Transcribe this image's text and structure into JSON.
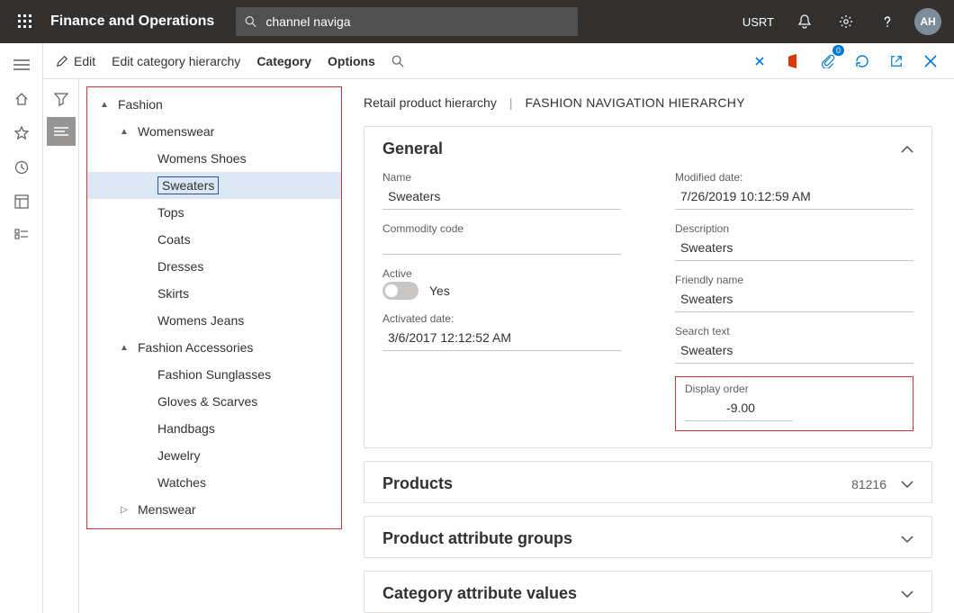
{
  "header": {
    "app_title": "Finance and Operations",
    "search_value": "channel naviga",
    "company": "USRT",
    "avatar": "AH"
  },
  "actionbar": {
    "edit": "Edit",
    "edit_hierarchy": "Edit category hierarchy",
    "category": "Category",
    "options": "Options"
  },
  "tree": {
    "root": "Fashion",
    "groups": [
      {
        "label": "Womenswear",
        "children": [
          "Womens Shoes",
          "Sweaters",
          "Tops",
          "Coats",
          "Dresses",
          "Skirts",
          "Womens Jeans"
        ],
        "selected_index": 1
      },
      {
        "label": "Fashion Accessories",
        "children": [
          "Fashion Sunglasses",
          "Gloves & Scarves",
          "Handbags",
          "Jewelry",
          "Watches"
        ]
      },
      {
        "label": "Menswear"
      }
    ]
  },
  "breadcrumb": {
    "a": "Retail product hierarchy",
    "b": "FASHION NAVIGATION HIERARCHY"
  },
  "general": {
    "title": "General",
    "name_label": "Name",
    "name_value": "Sweaters",
    "commodity_label": "Commodity code",
    "commodity_value": "",
    "active_label": "Active",
    "active_value": "Yes",
    "activated_label": "Activated date:",
    "activated_value": "3/6/2017 12:12:52 AM",
    "modified_label": "Modified date:",
    "modified_value": "7/26/2019 10:12:59 AM",
    "description_label": "Description",
    "description_value": "Sweaters",
    "friendly_label": "Friendly name",
    "friendly_value": "Sweaters",
    "search_label": "Search text",
    "search_value": "Sweaters",
    "displayorder_label": "Display order",
    "displayorder_value": "-9.00"
  },
  "sections": {
    "products_title": "Products",
    "products_count": "81216",
    "attr_groups_title": "Product attribute groups",
    "cat_attr_title": "Category attribute values"
  }
}
